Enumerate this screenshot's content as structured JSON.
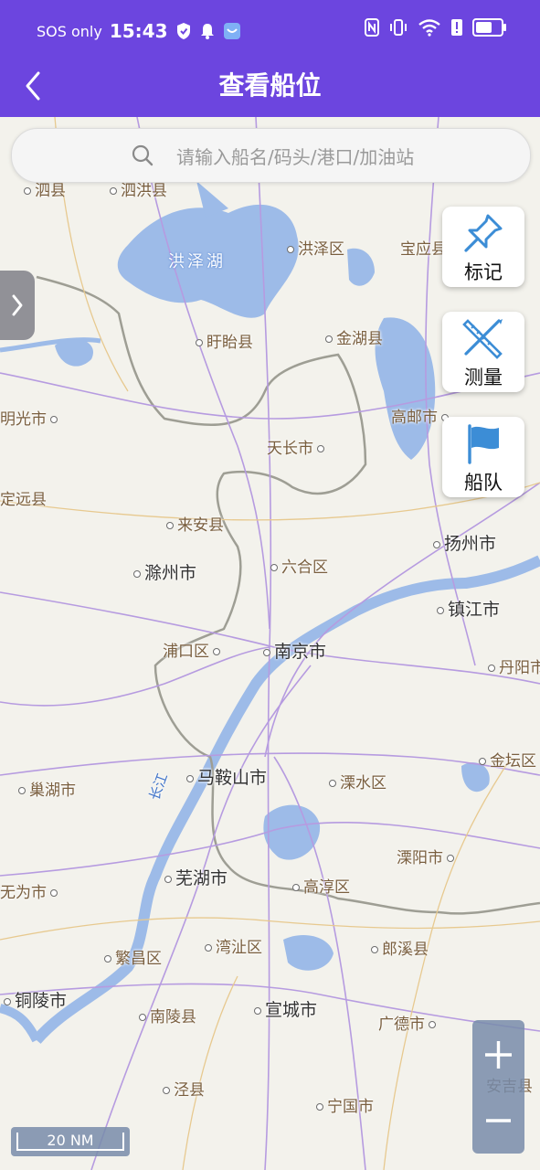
{
  "status_bar": {
    "carrier": "SOS only",
    "time": "15:43"
  },
  "header": {
    "title": "查看船位"
  },
  "search": {
    "placeholder": "请输入船名/码头/港口/加油站"
  },
  "tools": [
    {
      "label": "标记",
      "icon": "pin-icon"
    },
    {
      "label": "测量",
      "icon": "ruler-icon"
    },
    {
      "label": "船队",
      "icon": "flag-icon"
    }
  ],
  "map": {
    "scale_label": "20 NM",
    "places": {
      "sihong": "泗洪县",
      "si_county": "泗县",
      "hongze_lake": "洪泽湖",
      "hongze_district": "洪泽区",
      "baoying": "宝应县",
      "xuyi": "盱眙县",
      "jinhu": "金湖县",
      "mingguang": "明光市",
      "gaoyou": "高邮市",
      "tianchang": "天长市",
      "dingyuan": "定远县",
      "laian": "来安县",
      "yangzhou": "扬州市",
      "chuzhou": "滁州市",
      "liuhe": "六合区",
      "zhenjiang": "镇江市",
      "pukou": "浦口区",
      "nanjing": "南京市",
      "danyang": "丹阳市",
      "jintan": "金坛区",
      "chaohu": "巢湖市",
      "maanshan": "马鞍山市",
      "lishui": "溧水区",
      "changjiang": "长江",
      "liyang": "溧阳市",
      "wuhu": "芜湖市",
      "gaochun": "高淳区",
      "wuwei": "无为市",
      "fanchang": "繁昌区",
      "wanzhi": "湾沚区",
      "langxi": "郎溪县",
      "tongling": "铜陵市",
      "nanling": "南陵县",
      "xuancheng": "宣城市",
      "guangde": "广德市",
      "anji": "安吉县",
      "jingxian": "泾县",
      "ningguo": "宁国市"
    }
  }
}
